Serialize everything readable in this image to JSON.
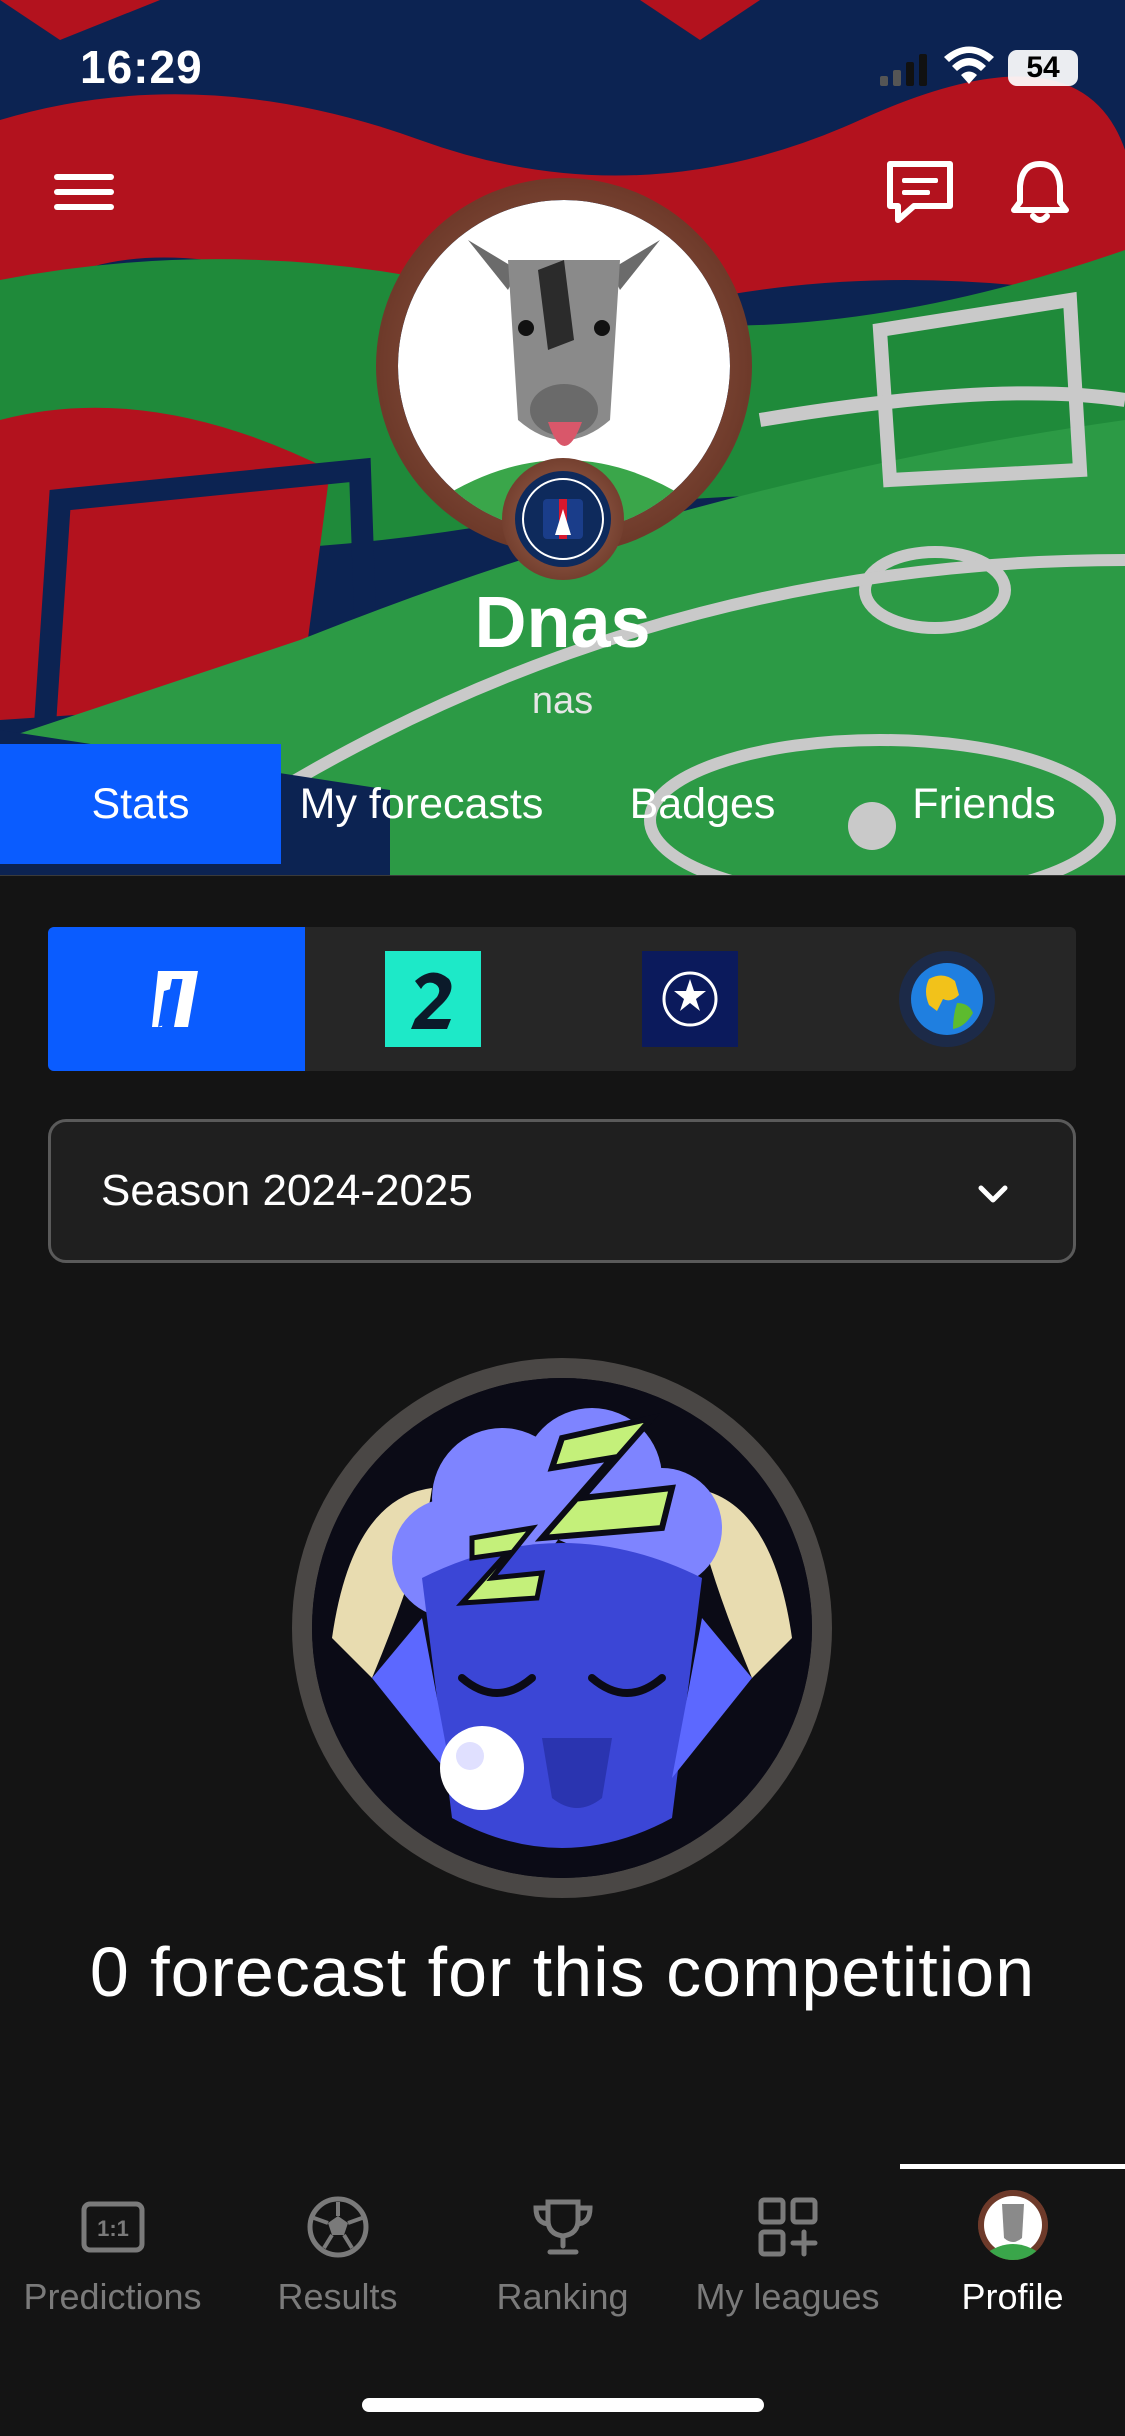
{
  "status_bar": {
    "time": "16:29",
    "battery": "54"
  },
  "profile": {
    "name": "Dnas",
    "handle": "nas"
  },
  "tabs": [
    {
      "label": "Stats",
      "active": true
    },
    {
      "label": "My forecasts",
      "active": false
    },
    {
      "label": "Badges",
      "active": false
    },
    {
      "label": "Friends",
      "active": false
    }
  ],
  "competitions": [
    {
      "icon": "ligue1-logo-icon",
      "active": true
    },
    {
      "icon": "ligue2-logo-icon",
      "active": false
    },
    {
      "icon": "champions-league-logo-icon",
      "active": false
    },
    {
      "icon": "world-globe-icon",
      "active": false
    }
  ],
  "season_select": {
    "value": "Season 2024-2025"
  },
  "empty_state": {
    "message": "0 forecast for this competition"
  },
  "bottom_nav": [
    {
      "label": "Predictions",
      "icon": "score-1-1-icon",
      "active": false
    },
    {
      "label": "Results",
      "icon": "soccer-ball-icon",
      "active": false
    },
    {
      "label": "Ranking",
      "icon": "trophy-icon",
      "active": false
    },
    {
      "label": "My leagues",
      "icon": "grid-plus-icon",
      "active": false
    },
    {
      "label": "Profile",
      "icon": "avatar-icon",
      "active": true
    }
  ],
  "colors": {
    "accent": "#0a5cff",
    "background": "#141414",
    "ligue2": "#1de9c8",
    "champions": "#0b1a5c"
  }
}
